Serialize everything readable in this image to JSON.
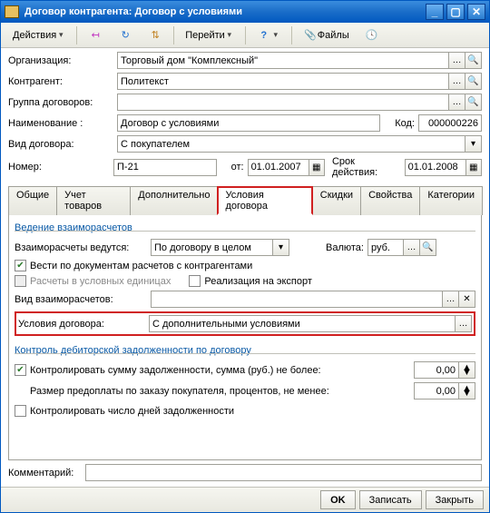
{
  "window_title": "Договор контрагента: Договор с условиями",
  "toolbar": {
    "actions": "Действия",
    "go": "Перейти",
    "files": "Файлы"
  },
  "form": {
    "org_label": "Организация:",
    "org_value": "Торговый дом \"Комплексный\"",
    "contr_label": "Контрагент:",
    "contr_value": "Политекст",
    "group_label": "Группа договоров:",
    "group_value": "",
    "name_label": "Наименование :",
    "name_value": "Договор с условиями",
    "code_label": "Код:",
    "code_value": "000000226",
    "type_label": "Вид договора:",
    "type_value": "С покупателем",
    "num_label": "Номер:",
    "num_value": "П-21",
    "from_label": "от:",
    "from_value": "01.01.2007",
    "validity_label": "Срок действия:",
    "validity_value": "01.01.2008"
  },
  "tabs": [
    "Общие",
    "Учет товаров",
    "Дополнительно",
    "Условия договора",
    "Скидки",
    "Свойства",
    "Категории"
  ],
  "active_tab": 3,
  "panel": {
    "group1_title": "Ведение взаиморасчетов",
    "settle_label": "Взаиморасчеты ведутся:",
    "settle_value": "По договору в целом",
    "currency_label": "Валюта:",
    "currency_value": "руб.",
    "chk_docs": "Вести по документам расчетов с контрагентами",
    "chk_cond_units": "Расчеты в условных единицах",
    "chk_export": "Реализация на экспорт",
    "settle_type_label": "Вид взаиморасчетов:",
    "settle_type_value": "",
    "cond_label": "Условия договора:",
    "cond_value": "С дополнительными условиями",
    "group2_title": "Контроль дебиторской задолженности по договору",
    "chk_control_sum": "Контролировать сумму задолженности, сумма (руб.) не более:",
    "control_sum_value": "0,00",
    "prepay_label": "Размер предоплаты по заказу покупателя, процентов, не менее:",
    "prepay_value": "0,00",
    "chk_days": "Контролировать число дней задолженности"
  },
  "comment_label": "Комментарий:",
  "comment_value": "",
  "footer": {
    "ok": "OK",
    "save": "Записать",
    "close": "Закрыть"
  }
}
